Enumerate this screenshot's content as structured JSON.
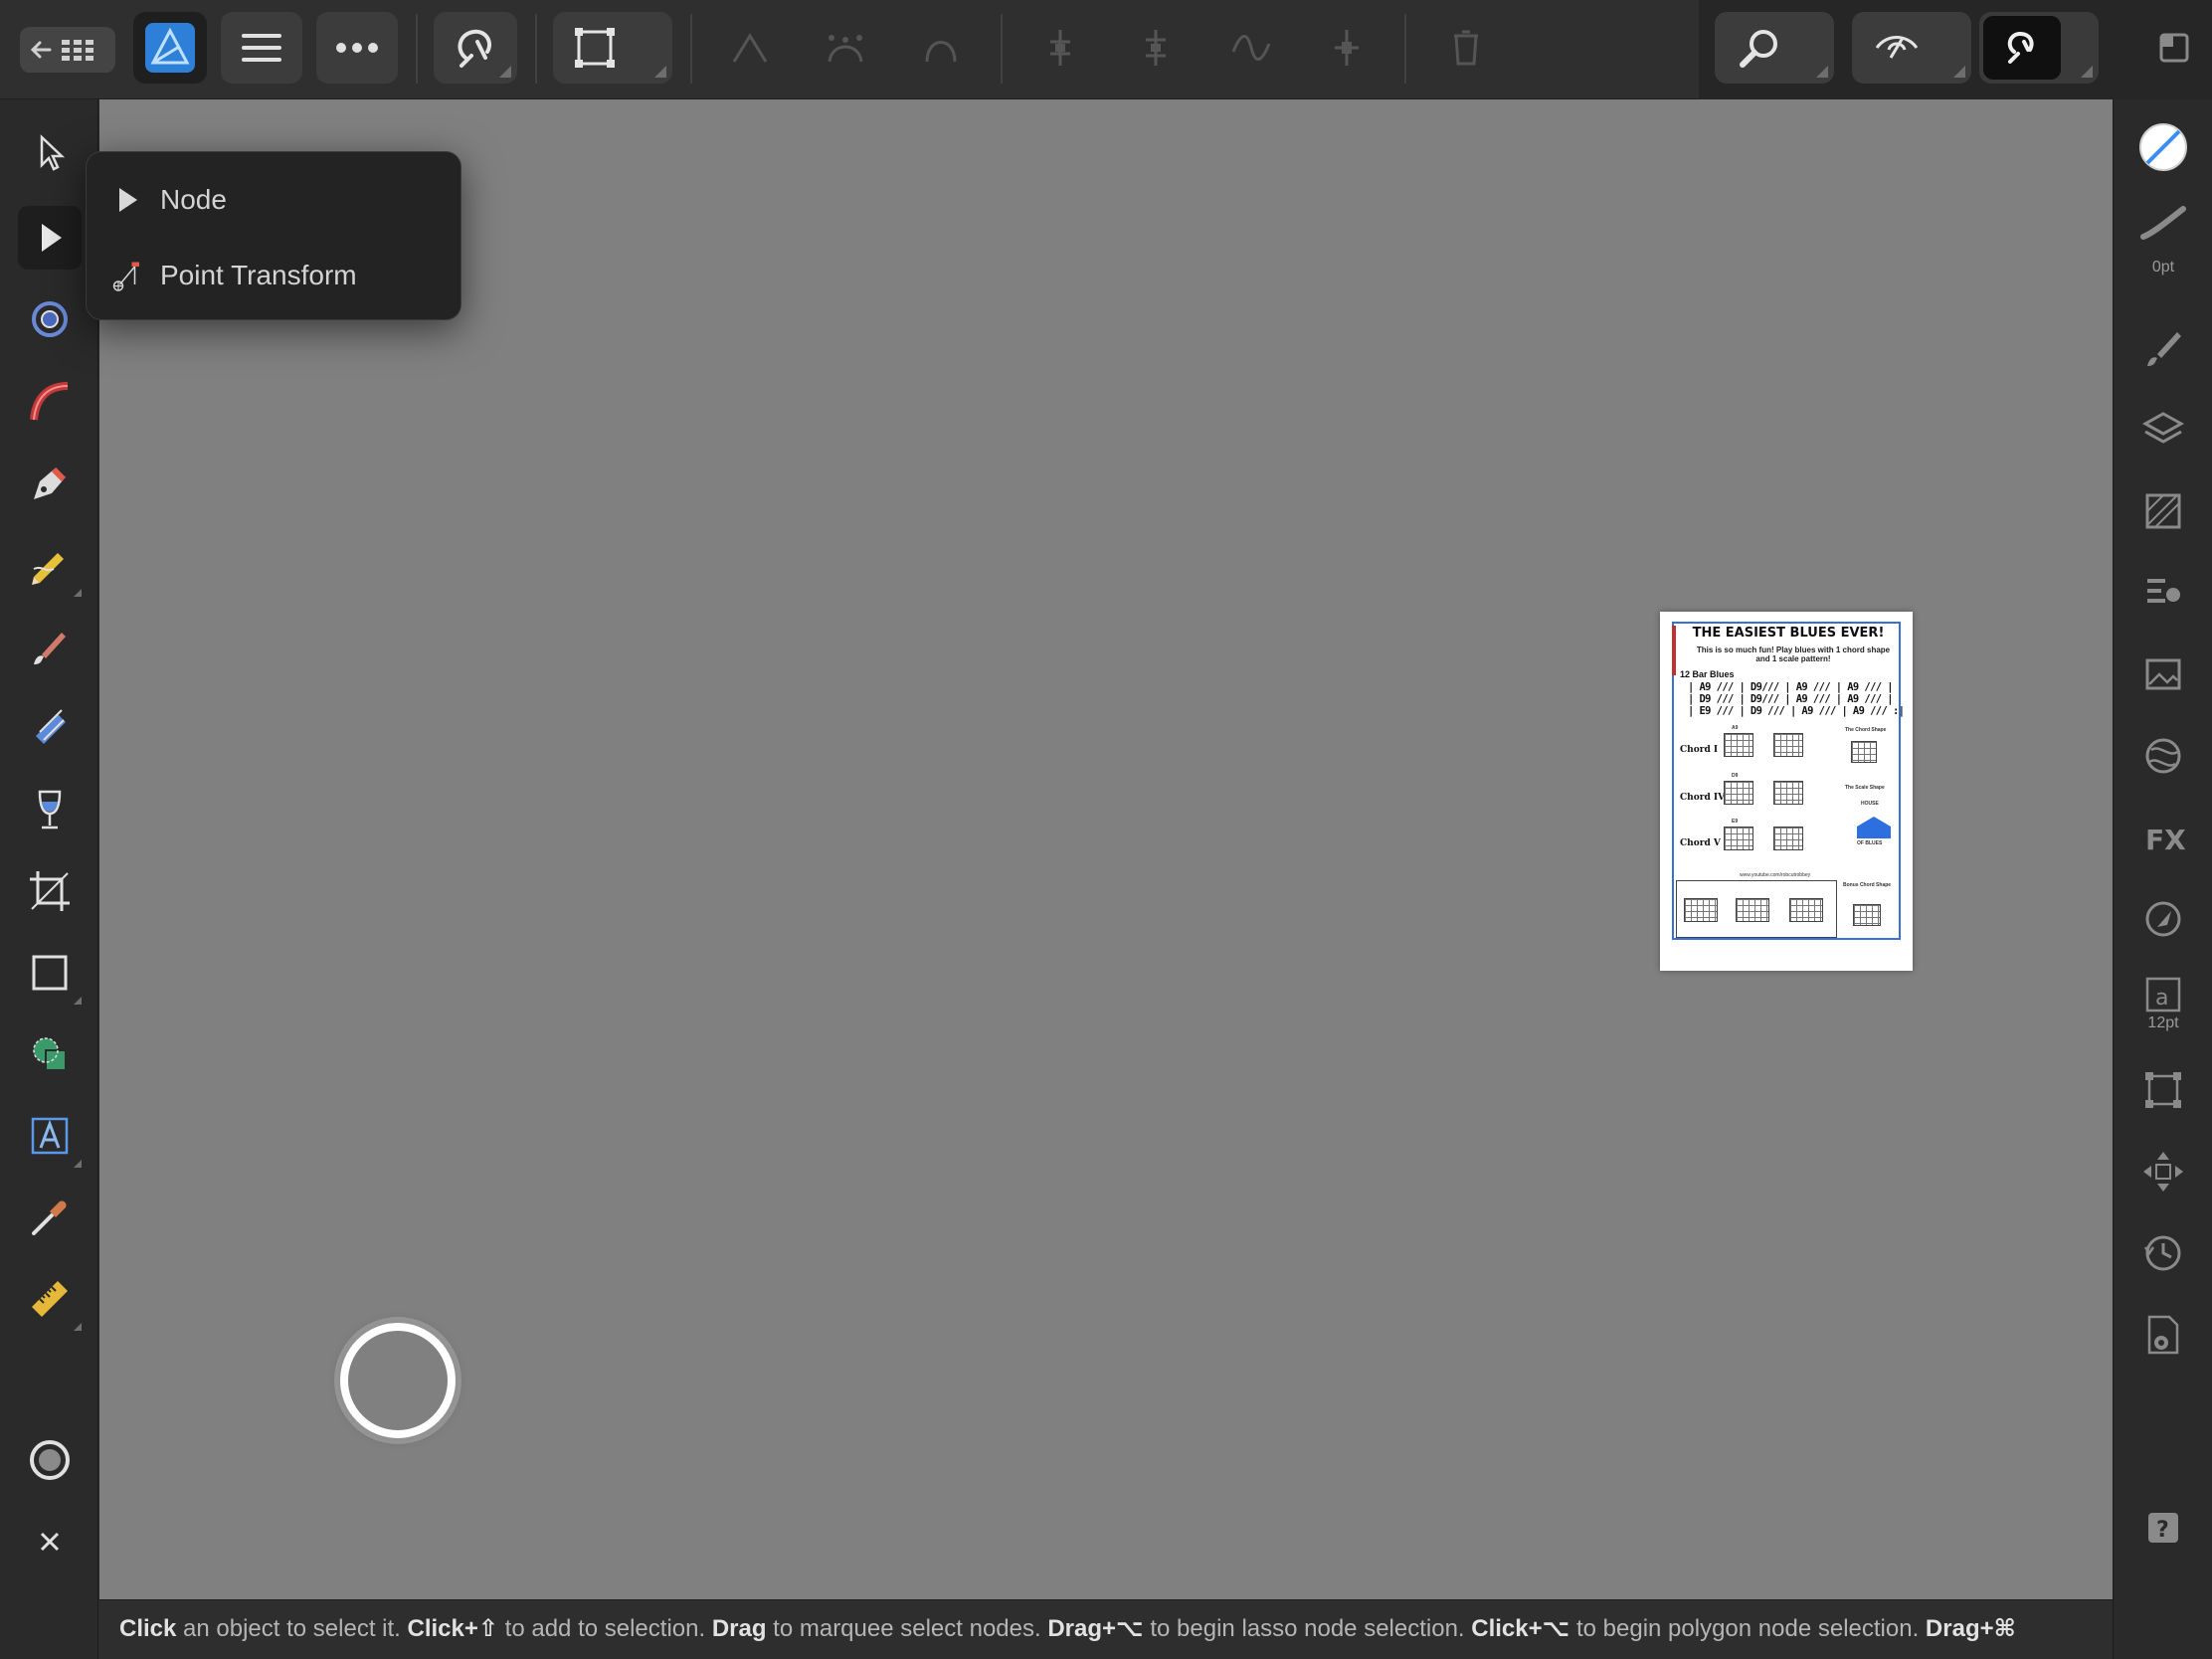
{
  "toolbar": {
    "back_label": "←",
    "more_label": "•••",
    "corner_panel_icon": "fullscreen-icon"
  },
  "popup_menu": {
    "items": [
      {
        "label": "Node",
        "icon": "node-arrow-icon"
      },
      {
        "label": "Point Transform",
        "icon": "point-transform-icon"
      }
    ]
  },
  "right_panels": {
    "stroke_width": "0pt",
    "text_size": "12pt"
  },
  "document": {
    "title": "THE EASIEST BLUES EVER!",
    "subtitle_line1": "This is so much fun! Play blues with 1 chord shape",
    "subtitle_line2": "and 1 scale pattern!",
    "heading": "12 Bar Blues",
    "bar_line1": "| A9 /// | D9/// | A9 /// | A9 /// |",
    "bar_line2": "| D9 /// | D9/// | A9 /// | A9 /// |",
    "bar_line3": "| E9 /// | D9 /// | A9 /// | A9 /// :|",
    "chord1": "Chord I",
    "chord4": "Chord IV",
    "chord5": "Chord V",
    "chord1_name": "A9",
    "chord4_name": "D9",
    "chord5_name": "E9",
    "chord_shape_label": "The Chord Shape",
    "scale_shape_label": "The Scale Shape",
    "house_top": "HOUSE",
    "house_bottom": "OF BLUES",
    "bonus_label": "Bonus Chord Shape",
    "footer_url": "www.youtube.com/robcutrobbey",
    "brand_color": "#3a6fd8"
  },
  "status": {
    "segments": [
      {
        "bold": "Click",
        "text": " an object to select it. "
      },
      {
        "bold": "Click+⇧",
        "text": " to add to selection. "
      },
      {
        "bold": "Drag",
        "text": " to marquee select nodes. "
      },
      {
        "bold": "Drag+⌥",
        "text": " to begin lasso node selection. "
      },
      {
        "bold": "Click+⌥",
        "text": " to begin polygon node selection. "
      },
      {
        "bold": "Drag+⌘",
        "text": ""
      }
    ]
  },
  "colors": {
    "canvas": "#808080",
    "accent_blue": "#3a8ef0",
    "affinity_logo": "#2d7fd8"
  }
}
